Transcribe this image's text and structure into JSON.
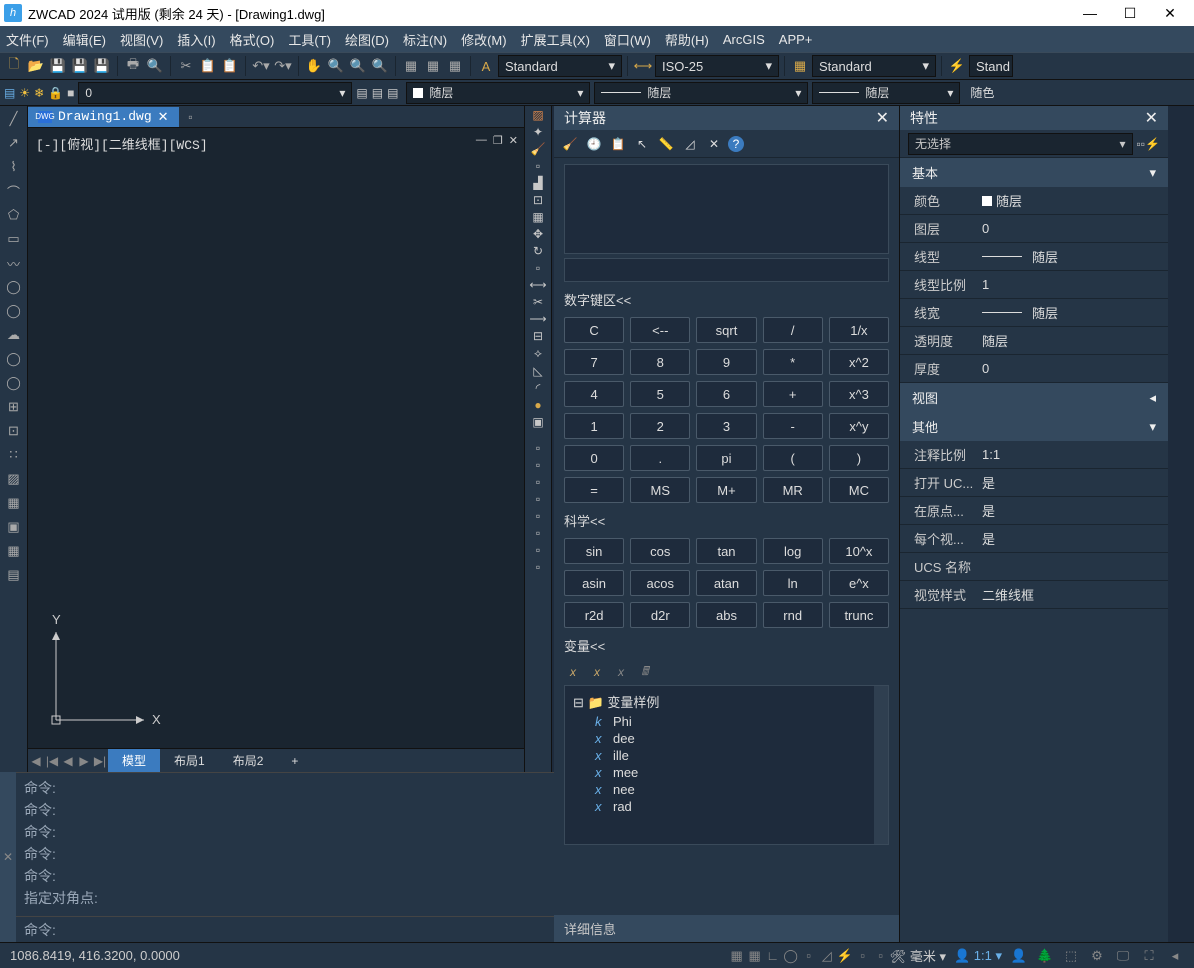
{
  "title": "ZWCAD 2024 试用版 (剩余 24 天) - [Drawing1.dwg]",
  "menu": [
    "文件(F)",
    "编辑(E)",
    "视图(V)",
    "插入(I)",
    "格式(O)",
    "工具(T)",
    "绘图(D)",
    "标注(N)",
    "修改(M)",
    "扩展工具(X)",
    "窗口(W)",
    "帮助(H)",
    "ArcGIS",
    "APP+"
  ],
  "styleDropdowns": {
    "textStyle": "Standard",
    "dimStyle": "ISO-25",
    "tableStyle": "Standard",
    "extraStyle": "Stand"
  },
  "layerRow": {
    "layerName": "0",
    "colorByLayer": "随层",
    "lineByLayer": "随层",
    "lwByLayer": "随层",
    "colorSel": "随色"
  },
  "drawingTab": "Drawing1.dwg",
  "viewportLabel": "[-][俯视][二维线框][WCS]",
  "modelTabs": {
    "active": "模型",
    "layouts": [
      "布局1",
      "布局2"
    ],
    "plus": "+"
  },
  "cmdHistory": [
    "命令:",
    "命令:",
    "命令:",
    "命令:",
    "命令:",
    "指定对角点:"
  ],
  "cmdPrompt": "命令:",
  "calc": {
    "title": "计算器",
    "numpadLabel": "数字键区<<",
    "numKeys": [
      "C",
      "<--",
      "sqrt",
      "/",
      "1/x",
      "7",
      "8",
      "9",
      "*",
      "x^2",
      "4",
      "5",
      "6",
      "+",
      "x^3",
      "1",
      "2",
      "3",
      "-",
      "x^y",
      "0",
      ".",
      "pi",
      "(",
      ")",
      "=",
      "MS",
      "M+",
      "MR",
      "MC"
    ],
    "sciLabel": "科学<<",
    "sciKeys": [
      "sin",
      "cos",
      "tan",
      "log",
      "10^x",
      "asin",
      "acos",
      "atan",
      "ln",
      "e^x",
      "r2d",
      "d2r",
      "abs",
      "rnd",
      "trunc"
    ],
    "varLabel": "变量<<",
    "varFolder": "变量样例",
    "vars": [
      {
        "sym": "k",
        "name": "Phi"
      },
      {
        "sym": "x",
        "name": "dee"
      },
      {
        "sym": "x",
        "name": "ille"
      },
      {
        "sym": "x",
        "name": "mee"
      },
      {
        "sym": "x",
        "name": "nee"
      },
      {
        "sym": "x",
        "name": "rad"
      }
    ],
    "detail": "详细信息"
  },
  "props": {
    "title": "特性",
    "noSelect": "无选择",
    "groups": {
      "basic": "基本",
      "view": "视图",
      "other": "其他"
    },
    "basic": [
      {
        "label": "颜色",
        "value": "随层",
        "swatch": true
      },
      {
        "label": "图层",
        "value": "0"
      },
      {
        "label": "线型",
        "value": "随层",
        "line": true
      },
      {
        "label": "线型比例",
        "value": "1"
      },
      {
        "label": "线宽",
        "value": "随层",
        "line": true
      },
      {
        "label": "透明度",
        "value": "随层"
      },
      {
        "label": "厚度",
        "value": "0"
      }
    ],
    "other": [
      {
        "label": "注释比例",
        "value": "1:1"
      },
      {
        "label": "打开 UC...",
        "value": "是"
      },
      {
        "label": "在原点...",
        "value": "是"
      },
      {
        "label": "每个视...",
        "value": "是"
      },
      {
        "label": "UCS 名称",
        "value": ""
      },
      {
        "label": "视觉样式",
        "value": "二维线框"
      }
    ]
  },
  "status": {
    "coords": "1086.8419,  416.3200,  0.0000",
    "units": "毫米",
    "annoscale": "1:1"
  }
}
